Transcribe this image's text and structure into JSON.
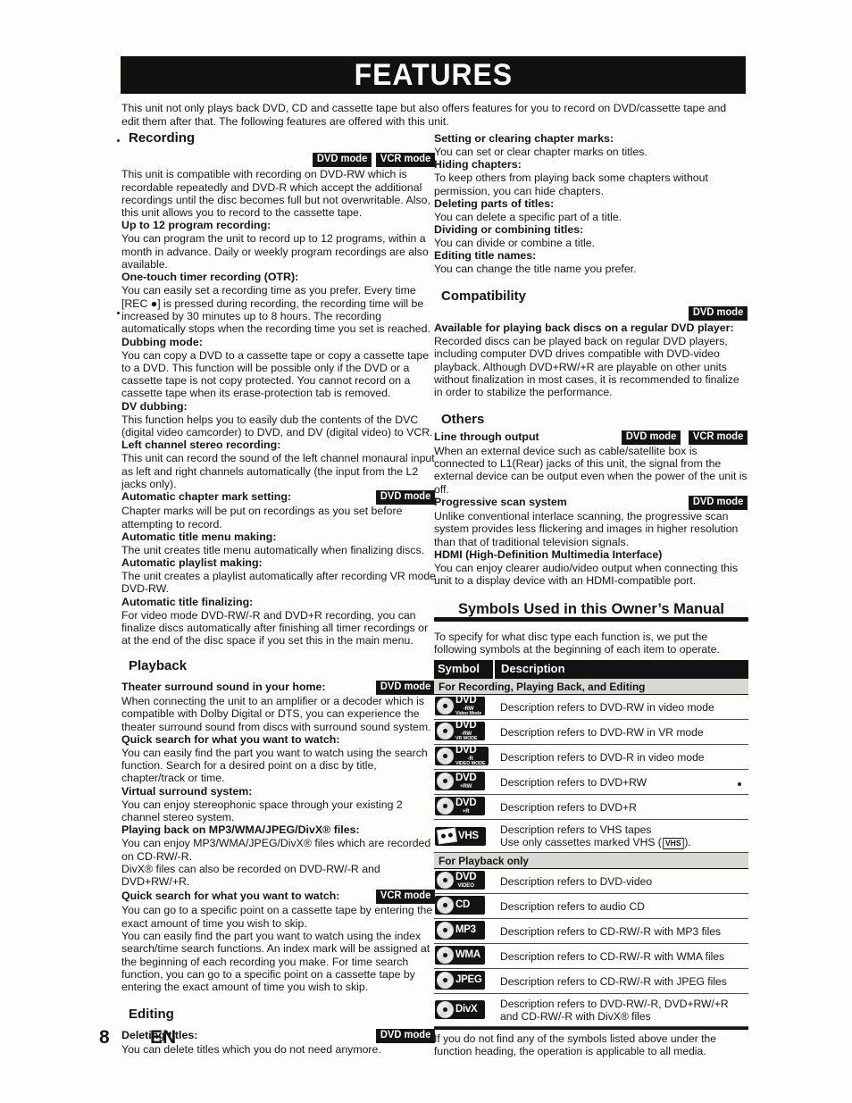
{
  "page": {
    "title": "FEATURES",
    "intro": "This unit not only plays back DVD, CD and cassette tape but also offers features for you to record on DVD/cassette tape and edit them after that. The following features are offered with this unit.",
    "page_number": "8",
    "language_code": "EN"
  },
  "badges": {
    "dvd_mode": "DVD mode",
    "vcr_mode": "VCR mode"
  },
  "left_column": {
    "sections": [
      {
        "heading": "Recording",
        "top_badges": [
          "DVD mode",
          "VCR mode"
        ],
        "lead": "This unit is compatible with recording on DVD-RW which is recordable repeatedly and DVD-R which accept the additional recordings until the disc becomes full but not overwritable. Also, this unit allows you to record to the cassette tape.",
        "items": [
          {
            "title": "Up to 12 program recording:",
            "badges": [],
            "body": "You can program the unit to record up to 12 programs, within a month in advance. Daily or weekly program recordings are also available."
          },
          {
            "title": "One-touch timer recording (OTR):",
            "badges": [],
            "body": "You can easily set a recording time as you prefer. Every time [REC ●] is pressed during recording, the recording time will be increased by 30 minutes up to 8 hours. The recording automatically stops when the recording time you set is reached."
          },
          {
            "title": "Dubbing mode:",
            "badges": [],
            "body": "You can copy a DVD to a cassette tape or copy a cassette tape to a DVD. This function will be possible only if the DVD or a cassette tape is not copy protected. You cannot record on a cassette tape when its erase-protection tab is removed."
          },
          {
            "title": "DV dubbing:",
            "badges": [],
            "body": "This function helps you to easily dub the contents of the DVC (digital video camcorder) to DVD, and DV (digital video) to VCR."
          },
          {
            "title": "Left channel stereo recording:",
            "badges": [],
            "body": "This unit can record the sound of the left channel monaural input as left and right channels automatically (the input from the L2 jacks only)."
          },
          {
            "title": "Automatic chapter mark setting:",
            "badges": [
              "DVD mode"
            ],
            "body": "Chapter marks will be put on recordings as you set before attempting to record."
          },
          {
            "title": "Automatic title menu making:",
            "badges": [],
            "body": "The unit creates title menu automatically when finalizing discs."
          },
          {
            "title": "Automatic playlist making:",
            "badges": [],
            "body": "The unit creates a playlist automatically after recording VR mode DVD-RW."
          },
          {
            "title": "Automatic title finalizing:",
            "badges": [],
            "body": "For video mode DVD-RW/-R and DVD+R recording, you can finalize discs automatically after finishing all timer recordings or at the end of the disc space if you set this in the main menu."
          }
        ]
      },
      {
        "heading": "Playback",
        "top_badges": [],
        "lead": "",
        "items": [
          {
            "title": "Theater surround sound in your home:",
            "badges": [
              "DVD mode"
            ],
            "body": "When connecting the unit to an amplifier or a decoder which is compatible with Dolby Digital or DTS, you can experience the theater surround sound from discs with surround sound system."
          },
          {
            "title": "Quick search for what you want to watch:",
            "badges": [],
            "body": "You can easily find the part you want to watch using the search function. Search for a desired point on a disc by title, chapter/track or time."
          },
          {
            "title": "Virtual surround system:",
            "badges": [],
            "body": "You can enjoy stereophonic space through your existing 2 channel stereo system."
          },
          {
            "title": "Playing back on MP3/WMA/JPEG/DivX® files:",
            "badges": [],
            "body": "You can enjoy MP3/WMA/JPEG/DivX® files which are recorded on CD-RW/-R.",
            "body2": "DivX® files can also be recorded on DVD-RW/-R and DVD+RW/+R."
          },
          {
            "title": "Quick search for what you want to watch:",
            "badges": [
              "VCR mode"
            ],
            "body": "You can go to a specific point on a cassette tape by entering the exact amount of time you wish to skip.",
            "body2": "You can easily find the part you want to watch using the index search/time search functions. An index mark will be assigned at the beginning of each recording you make. For time search function, you can go to a specific point on a cassette tape by entering the exact amount of time you wish to skip."
          }
        ]
      },
      {
        "heading": "Editing",
        "top_badges": [],
        "lead": "",
        "items": [
          {
            "title": "Deleting titles:",
            "badges": [
              "DVD mode"
            ],
            "body": "You can delete titles which you do not need anymore."
          }
        ]
      }
    ]
  },
  "right_column": {
    "editing_continued": [
      {
        "title": "Setting or clearing chapter marks:",
        "body": "You can set or clear chapter marks on titles."
      },
      {
        "title": "Hiding chapters:",
        "body": "To keep others from playing back some chapters without permission, you can hide chapters."
      },
      {
        "title": "Deleting parts of titles:",
        "body": "You can delete a specific part of a title."
      },
      {
        "title": "Dividing or combining titles:",
        "body": "You can divide or combine a title."
      },
      {
        "title": "Editing title names:",
        "body": "You can change the title name you prefer."
      }
    ],
    "sections": [
      {
        "heading": "Compatibility",
        "top_badges": [
          "DVD mode"
        ],
        "items": [
          {
            "title": "Available for playing back discs on a regular DVD player:",
            "badges": [],
            "body": "Recorded discs can be played back on regular DVD players, including computer DVD drives compatible with DVD-video playback. Although DVD+RW/+R are playable on other units without finalization in most cases, it is recommended to finalize in order to stabilize the performance."
          }
        ]
      },
      {
        "heading": "Others",
        "top_badges": [],
        "items": [
          {
            "title": "Line through output",
            "badges": [
              "DVD mode",
              "VCR mode"
            ],
            "body": "When an external device such as cable/satellite box is connected to L1(Rear) jacks of this unit, the signal from the external device can be output even when the power of the unit is off."
          },
          {
            "title": "Progressive scan system",
            "badges": [
              "DVD mode"
            ],
            "body": "Unlike conventional interlace scanning, the progressive scan system provides less flickering and images in higher resolution than that of traditional television signals."
          },
          {
            "title": "HDMI (High-Definition Multimedia Interface)",
            "badges": [],
            "body": "You can enjoy clearer audio/video output when connecting this unit to a display device with an HDMI-compatible port."
          }
        ]
      }
    ],
    "symbols": {
      "banner_title": "Symbols Used in this Owner’s Manual",
      "intro": "To specify for what disc type each function is, we put the following symbols at the beginning of each item to operate.",
      "col_symbol": "Symbol",
      "col_description": "Description",
      "group_recording": "For Recording, Playing Back, and Editing",
      "group_playback": "For Playback only",
      "rows_recording": [
        {
          "symbol": "dvd-rw-video-mode-icon",
          "l1": "DVD",
          "l2": "-RW",
          "l3": "Video Mode",
          "description": "Description refers to DVD-RW in video mode"
        },
        {
          "symbol": "dvd-rw-vr-mode-icon",
          "l1": "DVD",
          "l2": "-RW",
          "l3": "VR MODE",
          "description": "Description refers to DVD-RW in VR mode"
        },
        {
          "symbol": "dvd-r-video-mode-icon",
          "l1": "DVD",
          "l2": "-R",
          "l3": "VIDEO MODE",
          "description": "Description refers to DVD-R in video mode"
        },
        {
          "symbol": "dvd-plus-rw-icon",
          "l1": "DVD",
          "l2": "+RW",
          "l3": "",
          "description": "Description refers to DVD+RW"
        },
        {
          "symbol": "dvd-plus-r-icon",
          "l1": "DVD",
          "l2": "+R",
          "l3": "",
          "description": "Description refers to DVD+R"
        }
      ],
      "row_vhs": {
        "symbol": "vhs-tape-icon",
        "label": "VHS",
        "description_line1": "Description refers to VHS tapes",
        "description_line2_pre": "Use only cassettes marked VHS (",
        "description_line2_mark": "VHS",
        "description_line2_post": ")."
      },
      "rows_playback": [
        {
          "symbol": "dvd-video-icon",
          "l1": "DVD",
          "l2": "VIDEO",
          "l3": "",
          "description": "Description refers to DVD-video"
        },
        {
          "symbol": "audio-cd-icon",
          "l1": "CD",
          "l2": "",
          "l3": "",
          "description": "Description refers to audio CD"
        },
        {
          "symbol": "mp3-icon",
          "l1": "MP3",
          "l2": "",
          "l3": "",
          "description": "Description refers to CD-RW/-R with MP3 files"
        },
        {
          "symbol": "wma-icon",
          "l1": "WMA",
          "l2": "",
          "l3": "",
          "description": "Description refers to CD-RW/-R with WMA files"
        },
        {
          "symbol": "jpeg-icon",
          "l1": "JPEG",
          "l2": "",
          "l3": "",
          "description": "Description refers to CD-RW/-R with JPEG files"
        }
      ],
      "row_divx": {
        "symbol": "divx-icon",
        "label": "DivX",
        "description_line1": "Description refers to DVD-RW/-R,  DVD+RW/+R",
        "description_line2": "and CD-RW/-R with DivX® files"
      },
      "footer": "If you do not find any of the symbols listed above under the function heading, the operation is applicable to all media."
    }
  }
}
